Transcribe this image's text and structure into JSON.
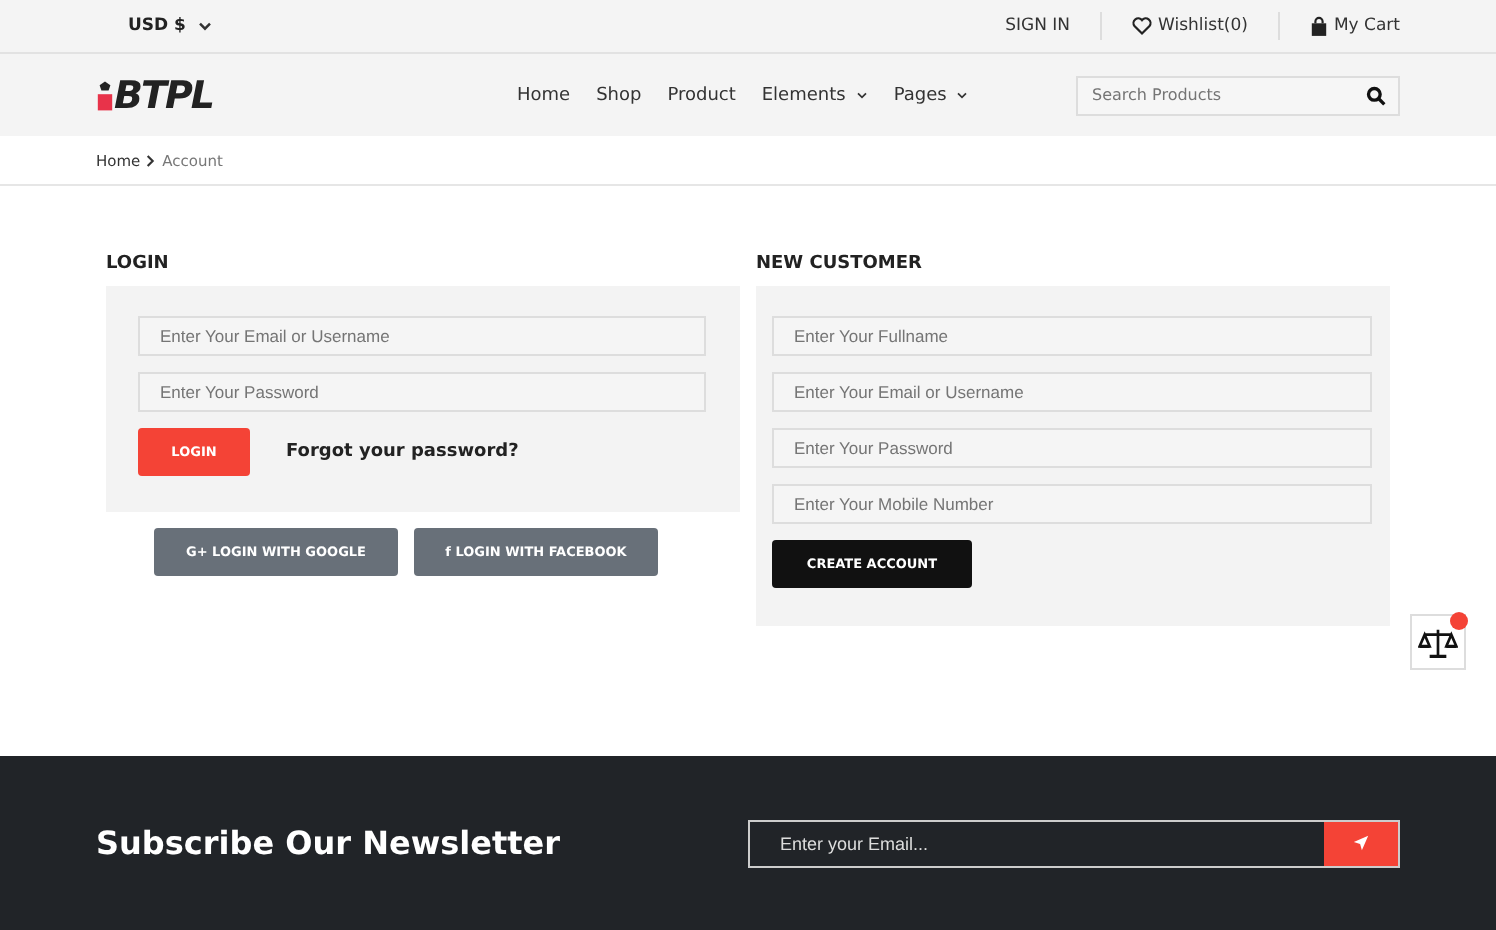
{
  "topbar": {
    "currency": "USD $",
    "sign_in": "SIGN IN",
    "wishlist": "Wishlist(0)",
    "cart": "My Cart"
  },
  "header": {
    "logo": "BTPL",
    "nav": [
      {
        "label": "Home",
        "dropdown": false
      },
      {
        "label": "Shop",
        "dropdown": false
      },
      {
        "label": "Product",
        "dropdown": false
      },
      {
        "label": "Elements",
        "dropdown": true
      },
      {
        "label": "Pages",
        "dropdown": true
      }
    ],
    "search": {
      "placeholder": "Search Products"
    }
  },
  "breadcrumb": [
    "Home",
    "Account"
  ],
  "login": {
    "title": "LOGIN",
    "fields": [
      {
        "placeholder": "Enter Your Email or Username"
      },
      {
        "placeholder": "Enter Your Password"
      }
    ],
    "button": "LOGIN",
    "forgot": "Forgot your password?",
    "social": [
      {
        "icon": "G+",
        "label": "LOGIN WITH GOOGLE"
      },
      {
        "icon": "f",
        "label": "LOGIN WITH FACEBOOK"
      }
    ]
  },
  "register": {
    "title": "NEW CUSTOMER",
    "fields": [
      {
        "placeholder": "Enter Your Fullname"
      },
      {
        "placeholder": "Enter Your Email or Username"
      },
      {
        "placeholder": "Enter Your Password"
      },
      {
        "placeholder": "Enter Your Mobile Number"
      }
    ],
    "button": "CREATE ACCOUNT"
  },
  "newsletter": {
    "title": "Subscribe Our Newsletter",
    "placeholder": "Enter your Email..."
  }
}
